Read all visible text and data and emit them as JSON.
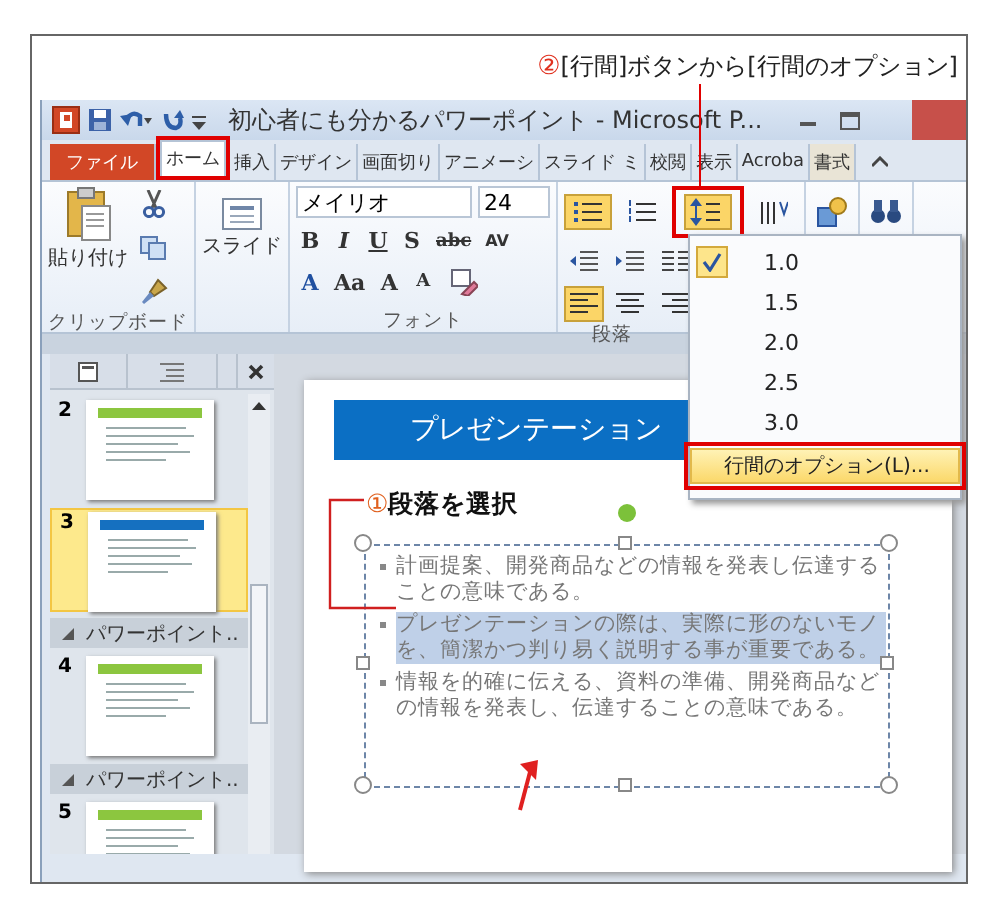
{
  "annotation": {
    "marker": "②",
    "text": "[行間]ボタンから[行間のオプション]"
  },
  "window": {
    "title": "初心者にも分かるパワーポイント - Microsoft P..."
  },
  "tabs": [
    {
      "label": "ファイル",
      "kind": "file",
      "selected": false,
      "highlighted": false
    },
    {
      "label": "ホーム",
      "kind": "tab",
      "selected": true,
      "highlighted": true
    },
    {
      "label": "挿入",
      "kind": "tab",
      "selected": false,
      "highlighted": false
    },
    {
      "label": "デザイン",
      "kind": "tab",
      "selected": false,
      "highlighted": false
    },
    {
      "label": "画面切り",
      "kind": "tab",
      "selected": false,
      "highlighted": false
    },
    {
      "label": "アニメーシ",
      "kind": "tab",
      "selected": false,
      "highlighted": false
    },
    {
      "label": "スライド ミ",
      "kind": "tab",
      "selected": false,
      "highlighted": false
    },
    {
      "label": "校閲",
      "kind": "tab",
      "selected": false,
      "highlighted": false
    },
    {
      "label": "表示",
      "kind": "tab",
      "selected": false,
      "highlighted": false
    },
    {
      "label": "Acroba",
      "kind": "tab",
      "selected": false,
      "highlighted": false
    },
    {
      "label": "書式",
      "kind": "context",
      "selected": false,
      "highlighted": false
    }
  ],
  "ribbon": {
    "paste_label": "貼り付け",
    "slide_label": "スライド",
    "font_name": "メイリオ",
    "font_size": "24",
    "font_buttons": [
      "B",
      "I",
      "U",
      "S",
      "abc",
      "AV"
    ],
    "font_buttons_2": [
      "A",
      "Aa",
      "A",
      "A"
    ],
    "paragraph_buttons": [
      {
        "kind": "bullets",
        "selected": true
      },
      {
        "kind": "numbering",
        "selected": false
      },
      {
        "kind": "line_spacing",
        "selected": true,
        "highlighted": true
      },
      {
        "kind": "text_direction",
        "selected": false
      }
    ],
    "align_buttons": [
      {
        "kind": "left",
        "selected": true
      },
      {
        "kind": "center",
        "selected": false
      },
      {
        "kind": "right",
        "selected": false
      }
    ],
    "group_labels": [
      "クリップボード",
      "フォント",
      "段落"
    ]
  },
  "line_spacing_menu": {
    "items": [
      {
        "label": "1.0",
        "checked": true
      },
      {
        "label": "1.5",
        "checked": false
      },
      {
        "label": "2.0",
        "checked": false
      },
      {
        "label": "2.5",
        "checked": false
      },
      {
        "label": "3.0",
        "checked": false
      }
    ],
    "options": {
      "label": "行間のオプション(L)...",
      "highlighted": true
    }
  },
  "slide_panel": {
    "items": [
      {
        "kind": "slide",
        "number": "2",
        "selected": false,
        "color": "#8cc63f"
      },
      {
        "kind": "slide",
        "number": "3",
        "selected": true,
        "color": "#1570c0"
      },
      {
        "kind": "section",
        "label": "パワーポイント.."
      },
      {
        "kind": "slide",
        "number": "4",
        "selected": false,
        "color": "#8cc63f"
      },
      {
        "kind": "section",
        "label": "パワーポイント.."
      },
      {
        "kind": "slide",
        "number": "5",
        "selected": false,
        "color": "#8cc63f"
      }
    ]
  },
  "slide": {
    "title": "プレゼンテーション",
    "annotation": {
      "marker": "①",
      "text": "段落を選択"
    },
    "bullets": [
      {
        "text": "計画提案、開発商品などの情報を発表し伝達することの意味である。",
        "selected": false
      },
      {
        "text": "プレゼンテーションの際は、実際に形のないモノを、簡潔かつ判り易く説明する事が重要である。",
        "selected": true
      },
      {
        "text": "情報を的確に伝える、資料の準備、開発商品などの情報を発表し、伝達することの意味である。",
        "selected": false
      }
    ]
  }
}
